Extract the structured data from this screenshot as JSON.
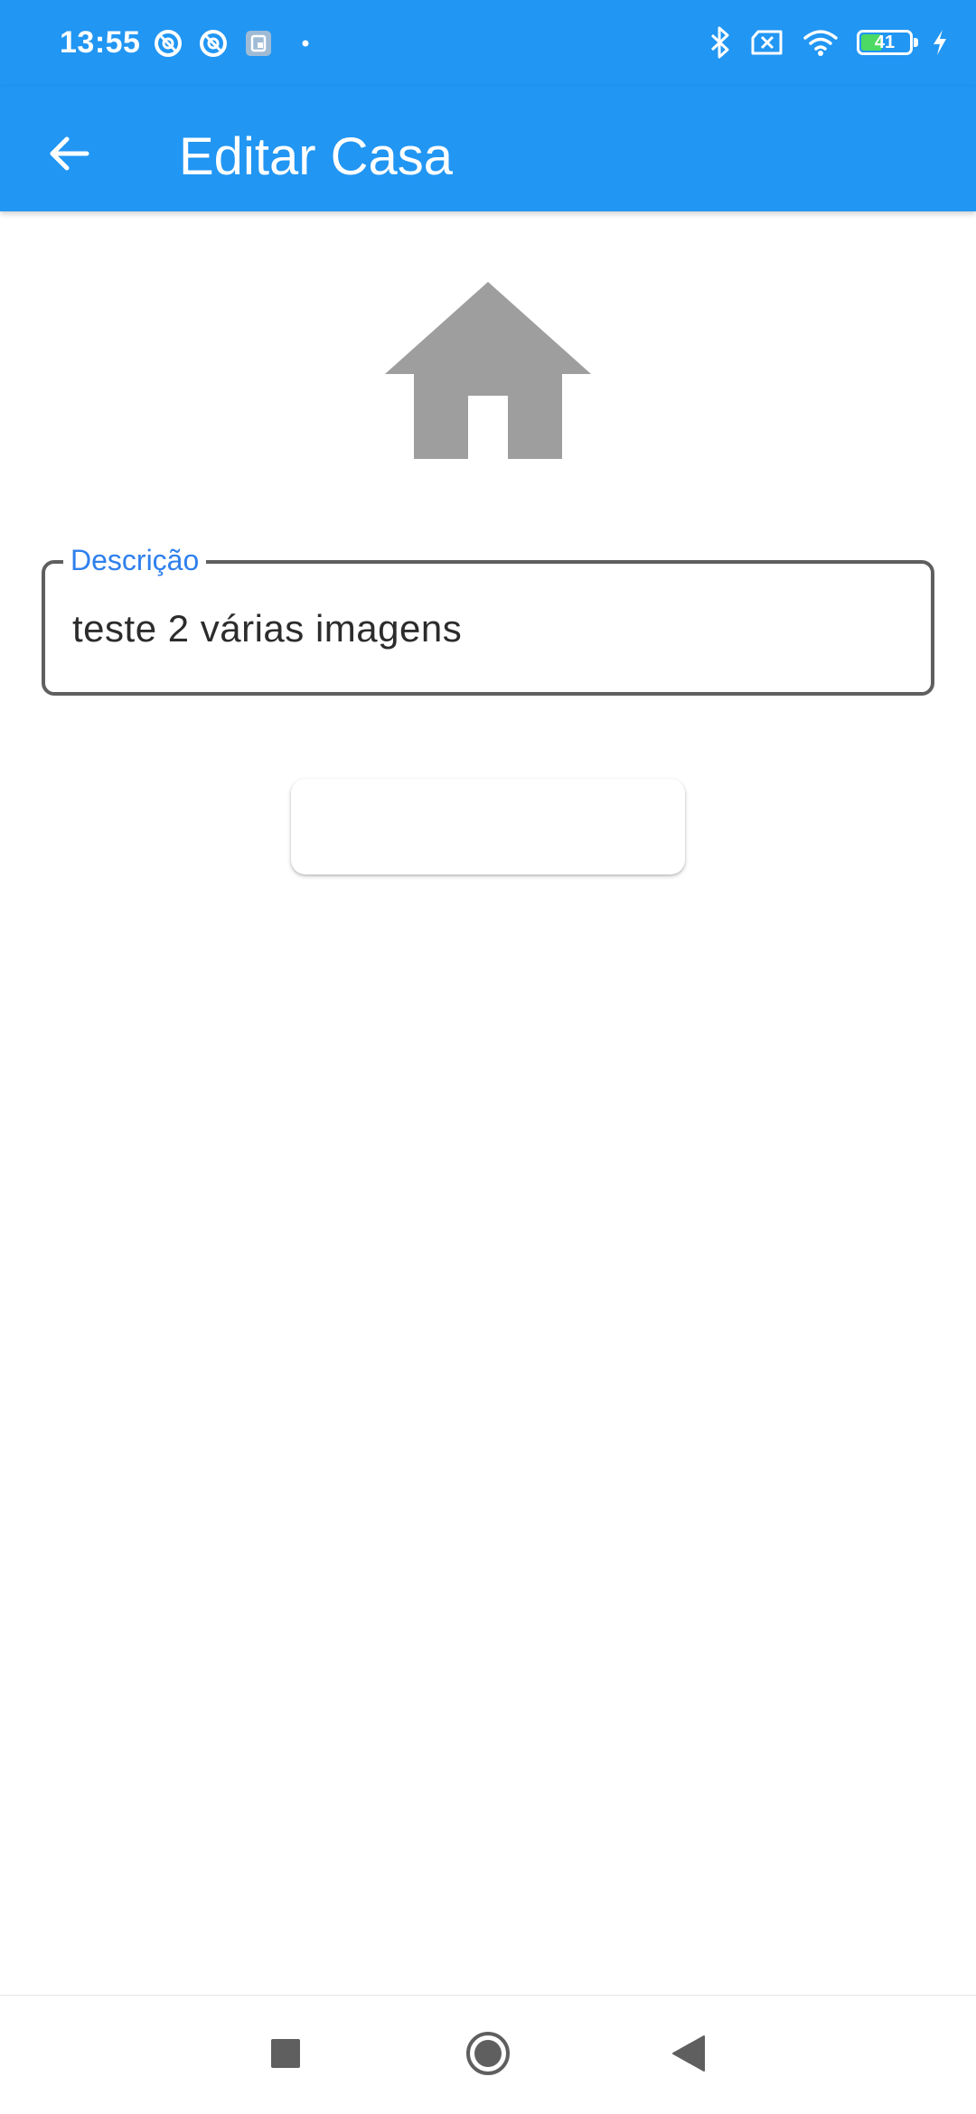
{
  "status_bar": {
    "time": "13:55",
    "battery_level": "41",
    "battery_fraction": 0.41,
    "background_color": "#2196f3",
    "left_icons": [
      "data-saver-icon",
      "data-saver-icon",
      "screen-record-icon",
      "dot-icon"
    ],
    "right_icons": [
      "bluetooth-icon",
      "no-sim-icon",
      "wifi-icon",
      "battery-icon",
      "charging-icon"
    ]
  },
  "app_bar": {
    "title": "Editar Casa",
    "back_icon": "arrow-back-icon",
    "background_color": "#2196f3"
  },
  "content": {
    "image_icon": "house-icon",
    "icon_color": "#9e9e9e",
    "description_field": {
      "label": "Descrição",
      "value": "teste 2 várias imagens",
      "label_color": "#2f80ed"
    },
    "action_button": {
      "label": ""
    }
  },
  "navigation_bar": {
    "buttons": [
      "recents-square-icon",
      "home-circle-icon",
      "back-triangle-icon"
    ]
  }
}
